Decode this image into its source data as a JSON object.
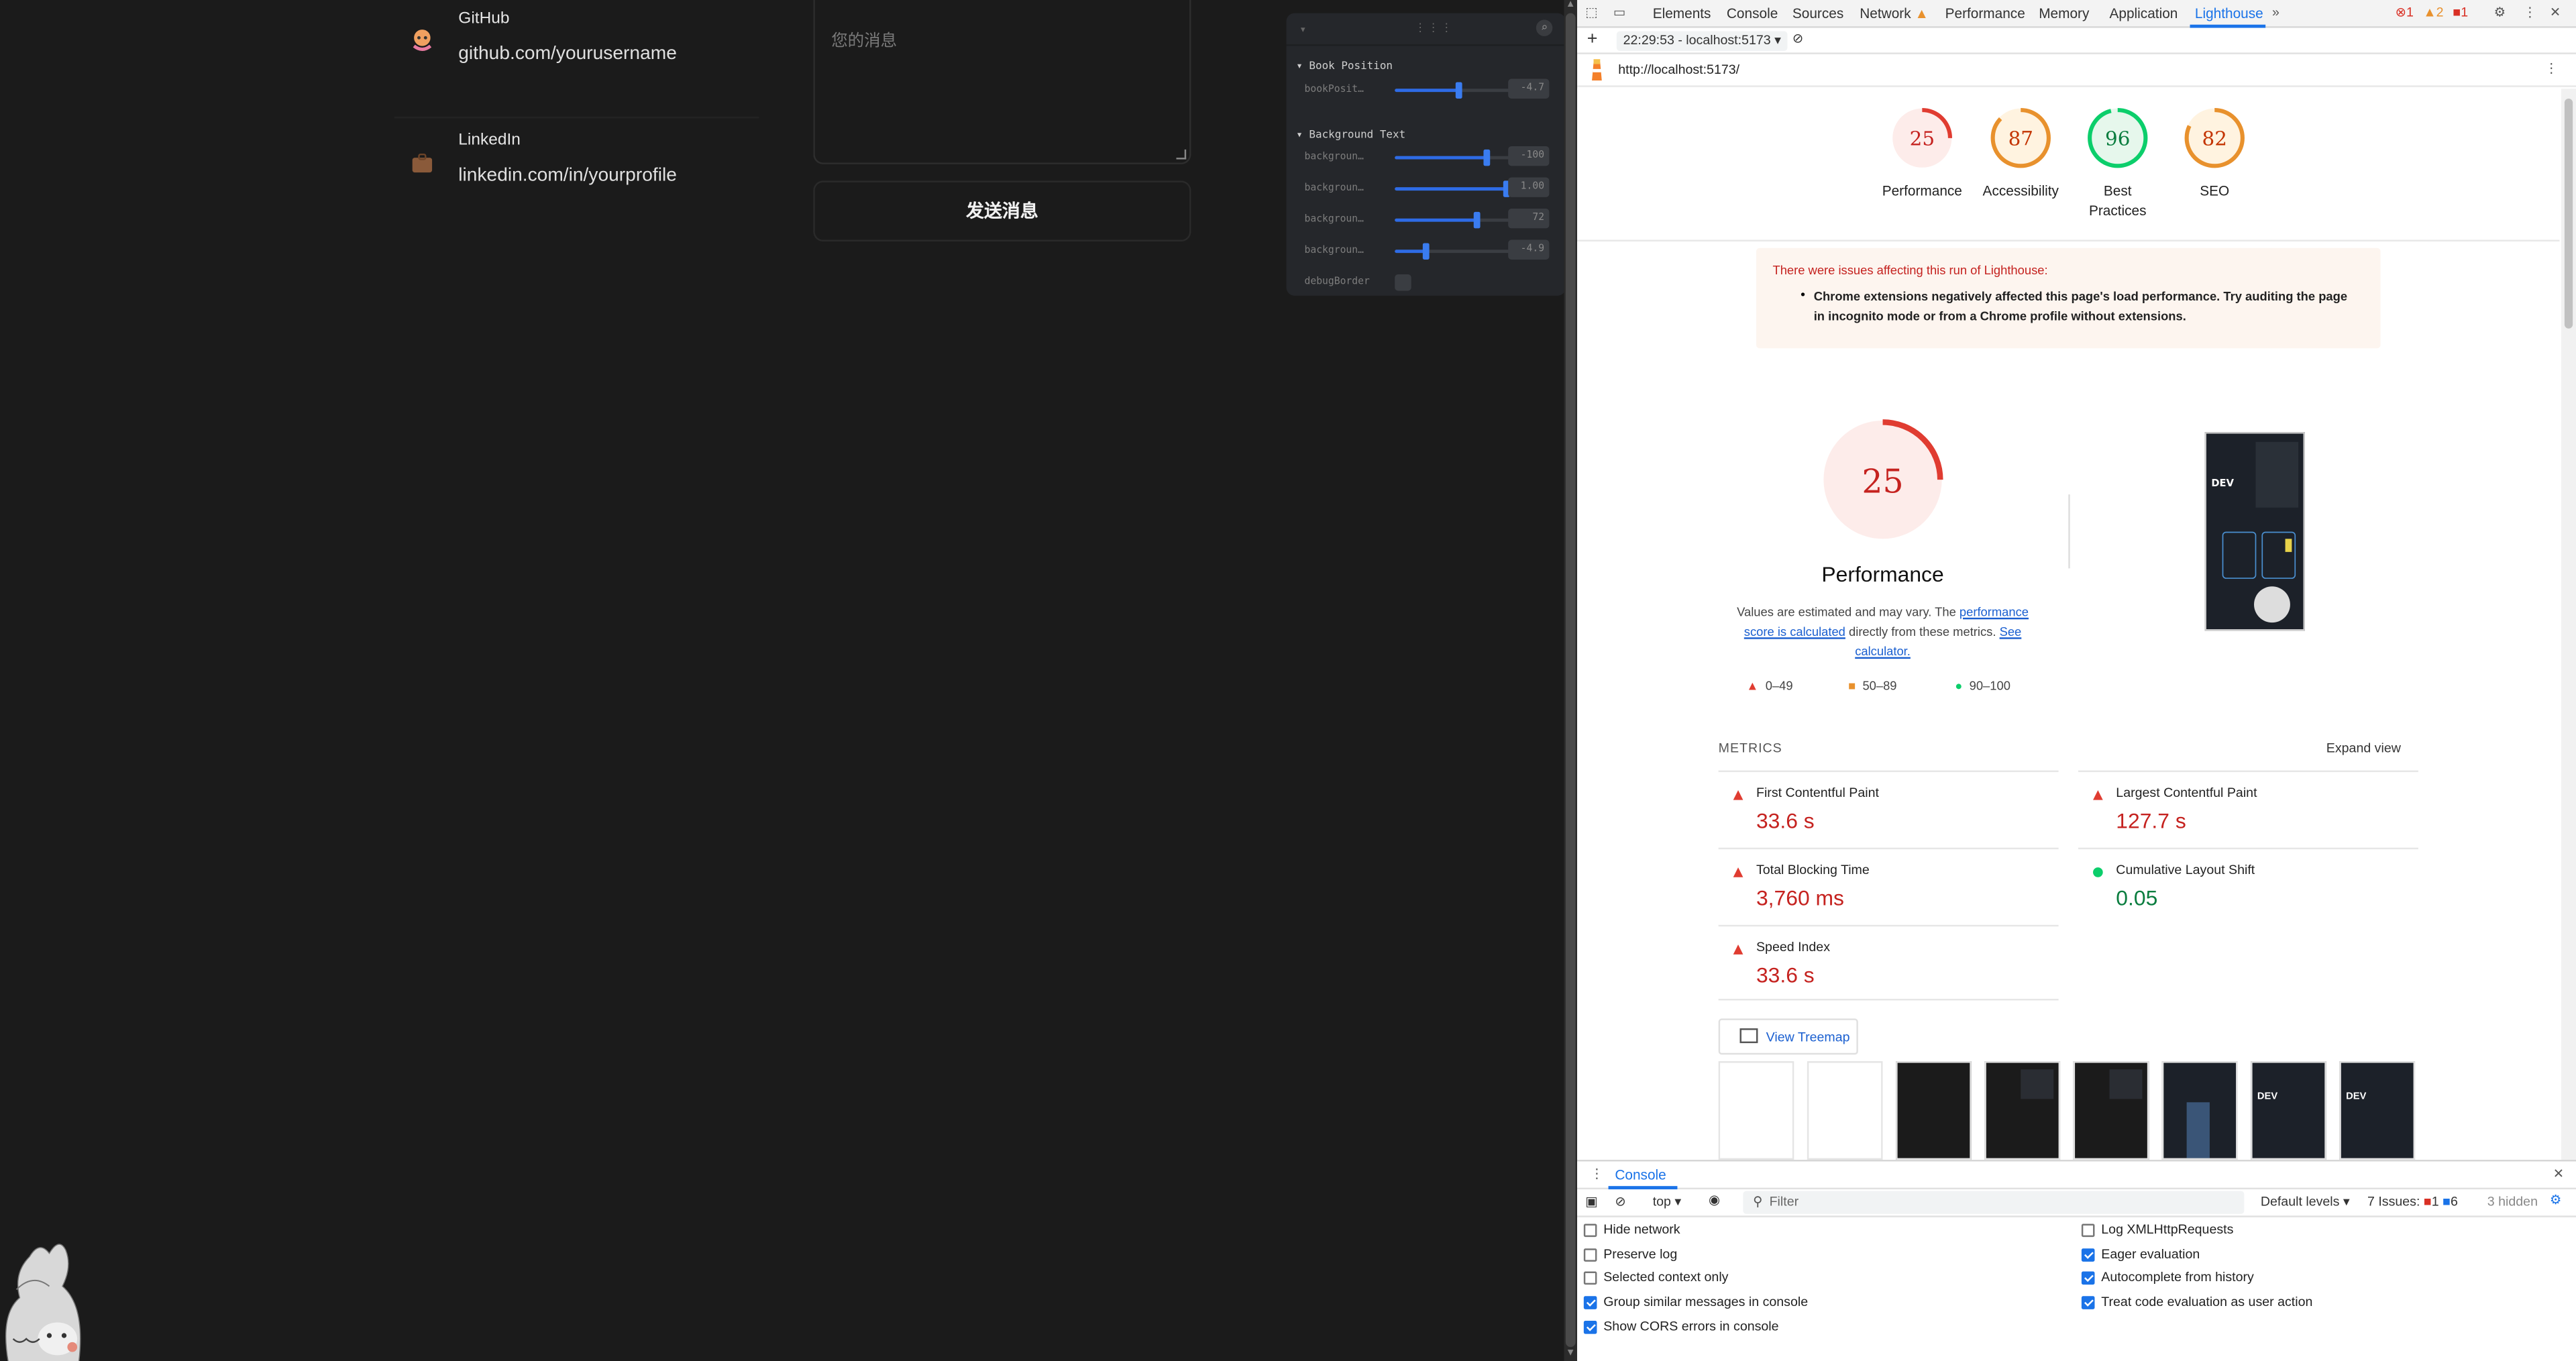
{
  "page": {
    "contacts": [
      {
        "title": "GitHub",
        "value": "github.com/yourusername",
        "icon": "octocat-icon"
      },
      {
        "title": "LinkedIn",
        "value": "linkedin.com/in/yourprofile",
        "icon": "briefcase-icon"
      }
    ],
    "message_placeholder": "您的消息",
    "send_button": "发送消息"
  },
  "gui": {
    "folders": [
      {
        "title": "Book Position",
        "rows": [
          {
            "name": "bookPosit…",
            "value": "-4.7",
            "fill": 0.55
          }
        ]
      },
      {
        "title": "Background Text",
        "rows": [
          {
            "name": "backgroun…",
            "value": "-100",
            "fill": 0.8
          },
          {
            "name": "backgroun…",
            "value": "1.00",
            "fill": 0.97
          },
          {
            "name": "backgroun…",
            "value": "72",
            "fill": 0.72
          },
          {
            "name": "backgroun…",
            "value": "-4.9",
            "fill": 0.27
          }
        ]
      },
      {
        "checkbox_label": "debugBorder"
      }
    ]
  },
  "devtools": {
    "tabs": [
      "Elements",
      "Console",
      "Sources",
      "Network",
      "Performance",
      "Memory",
      "Application",
      "Lighthouse"
    ],
    "active_tab": "Lighthouse",
    "issues": {
      "errors": "1",
      "warnings": "2",
      "info": "1"
    },
    "report_selector": "22:29:53 - localhost:5173",
    "url": "http://localhost:5173/",
    "scores": [
      {
        "label": "Performance",
        "value": "25",
        "color": "#e03c31"
      },
      {
        "label": "Accessibility",
        "value": "87",
        "color": "#e8912d"
      },
      {
        "label": "Best Practices",
        "value": "96",
        "color": "#0cce6b"
      },
      {
        "label": "SEO",
        "value": "82",
        "color": "#e8912d"
      }
    ],
    "warning_title": "There were issues affecting this run of Lighthouse:",
    "warning_item": "Chrome extensions negatively affected this page's load performance. Try auditing the page in incognito mode or from a Chrome profile without extensions.",
    "perf_title": "Performance",
    "perf_desc_1": "Values are estimated and may vary. The ",
    "perf_link_1": "performance score is calculated",
    "perf_desc_2": " directly from these metrics. ",
    "perf_link_2": "See calculator.",
    "legend": [
      "0–49",
      "50–89",
      "90–100"
    ],
    "metrics_header": "METRICS",
    "expand_view": "Expand view",
    "metrics": [
      {
        "name": "First Contentful Paint",
        "value": "33.6 s",
        "status": "fail"
      },
      {
        "name": "Largest Contentful Paint",
        "value": "127.7 s",
        "status": "fail"
      },
      {
        "name": "Total Blocking Time",
        "value": "3,760 ms",
        "status": "fail"
      },
      {
        "name": "Cumulative Layout Shift",
        "value": "0.05",
        "status": "pass"
      },
      {
        "name": "Speed Index",
        "value": "33.6 s",
        "status": "fail"
      }
    ],
    "view_treemap": "View Treemap",
    "drawer": {
      "tab": "Console",
      "context": "top",
      "filter_placeholder": "Filter",
      "levels": "Default levels",
      "issues_label": "7 Issues:",
      "issues_errors": "1",
      "issues_info": "6",
      "hidden": "3 hidden",
      "left_options": [
        {
          "label": "Hide network",
          "checked": false
        },
        {
          "label": "Preserve log",
          "checked": false
        },
        {
          "label": "Selected context only",
          "checked": false
        },
        {
          "label": "Group similar messages in console",
          "checked": true
        },
        {
          "label": "Show CORS errors in console",
          "checked": true
        }
      ],
      "right_options": [
        {
          "label": "Log XMLHttpRequests",
          "checked": false
        },
        {
          "label": "Eager evaluation",
          "checked": true
        },
        {
          "label": "Autocomplete from history",
          "checked": true
        },
        {
          "label": "Treat code evaluation as user action",
          "checked": true
        }
      ]
    }
  }
}
